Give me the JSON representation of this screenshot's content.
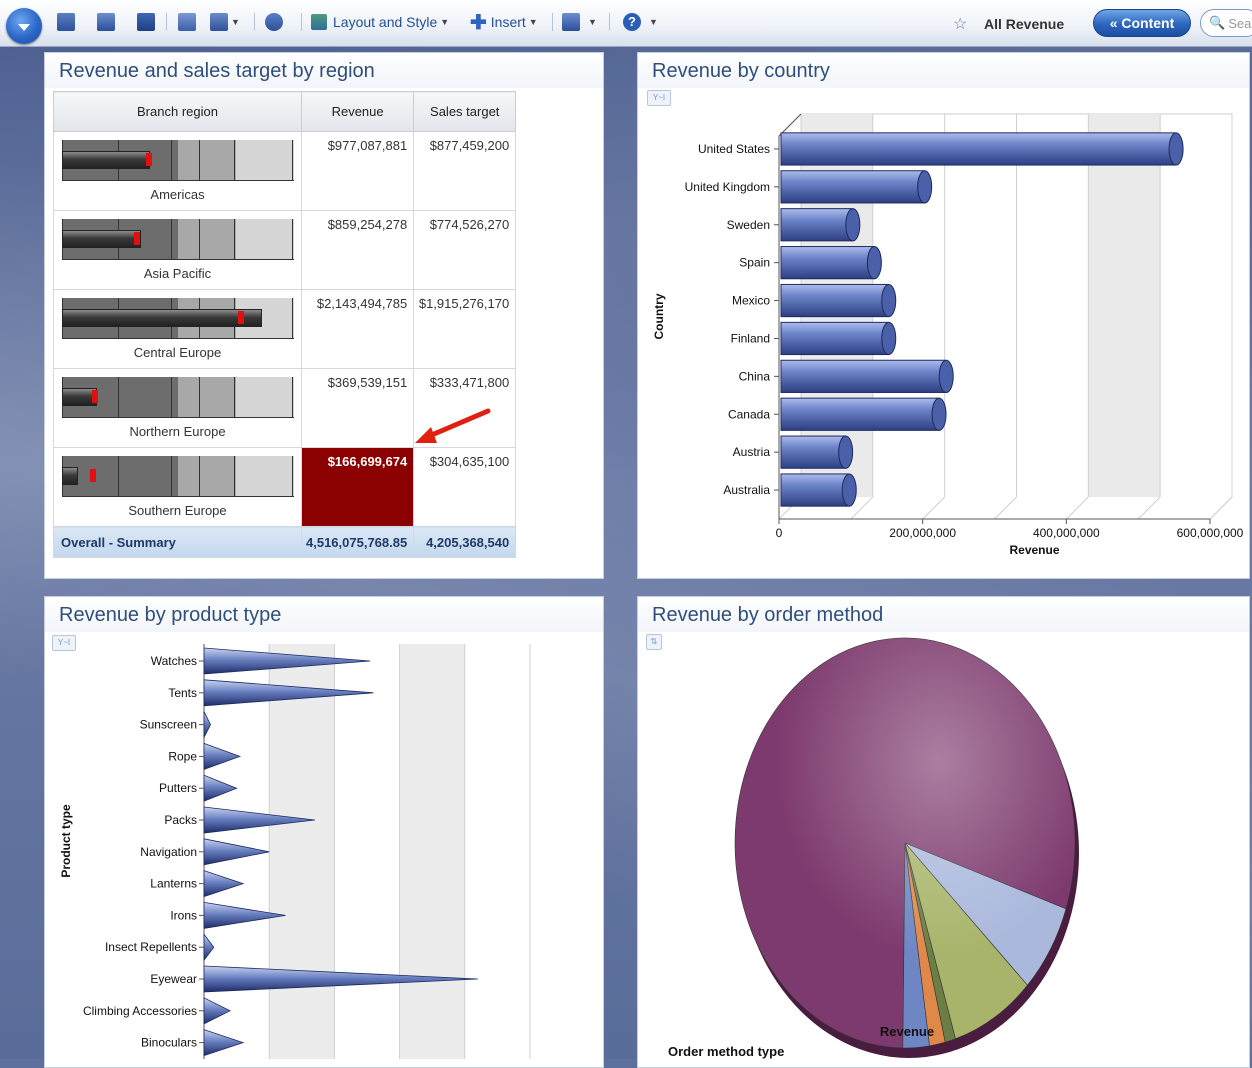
{
  "toolbar": {
    "menu_button": "menu",
    "layout_style": "Layout and Style",
    "insert": "Insert",
    "current_dashboard": "All Revenue",
    "content_button": "« Content",
    "search_placeholder": "Sear"
  },
  "panels": {
    "region": {
      "title": "Revenue and sales target by region",
      "columns": [
        "Branch region",
        "Revenue",
        "Sales target"
      ],
      "rows": [
        {
          "region": "Americas",
          "revenue": "$977,087,881",
          "target": "$877,459,200",
          "measure": 0.38,
          "marker": 0.36
        },
        {
          "region": "Asia Pacific",
          "revenue": "$859,254,278",
          "target": "$774,526,270",
          "measure": 0.34,
          "marker": 0.31
        },
        {
          "region": "Central Europe",
          "revenue": "$2,143,494,785",
          "target": "$1,915,276,170",
          "measure": 0.86,
          "marker": 0.76
        },
        {
          "region": "Northern Europe",
          "revenue": "$369,539,151",
          "target": "$333,471,800",
          "measure": 0.15,
          "marker": 0.13
        },
        {
          "region": "Southern Europe",
          "revenue": "$166,699,674",
          "target": "$304,635,100",
          "measure": 0.07,
          "marker": 0.12
        }
      ],
      "summary": {
        "label": "Overall - Summary",
        "revenue": "4,516,075,768.85",
        "target": "4,205,368,540"
      }
    },
    "country": {
      "title": "Revenue by country"
    },
    "product": {
      "title": "Revenue by product type"
    },
    "order": {
      "title": "Revenue by order method"
    }
  },
  "chart_data": [
    {
      "type": "bar",
      "orientation": "horizontal",
      "categories": [
        "United States",
        "United Kingdom",
        "Sweden",
        "Spain",
        "Mexico",
        "Finland",
        "China",
        "Canada",
        "Austria",
        "Australia"
      ],
      "values": [
        550000000,
        200000000,
        100000000,
        130000000,
        150000000,
        150000000,
        230000000,
        220000000,
        90000000,
        95000000
      ],
      "xlabel": "Revenue",
      "ylabel": "Country",
      "xticks": [
        "0",
        "200,000,000",
        "400,000,000",
        "600,000,000"
      ],
      "xlim": [
        0,
        600000000
      ],
      "color": "#5a72b8"
    },
    {
      "type": "bar",
      "orientation": "horizontal",
      "categories": [
        "Watches",
        "Tents",
        "Sunscreen",
        "Rope",
        "Putters",
        "Packs",
        "Navigation",
        "Lanterns",
        "Irons",
        "Insect Repellents",
        "Eyewear",
        "Climbing Accessories",
        "Binoculars"
      ],
      "values": [
        255,
        260,
        10,
        55,
        50,
        170,
        100,
        60,
        125,
        15,
        420,
        40,
        60
      ],
      "ylabel": "Product type",
      "xlim": [
        0,
        500
      ],
      "color": "#5a72b8"
    },
    {
      "type": "pie",
      "xlabel": "Revenue",
      "legend_title": "Order method type",
      "values": [
        80,
        7,
        8,
        1,
        1.5,
        2.5
      ],
      "colors": [
        "#7d3a6e",
        "#aab8dc",
        "#a8b46a",
        "#6b7e44",
        "#e0884a",
        "#6e86c4"
      ]
    }
  ]
}
